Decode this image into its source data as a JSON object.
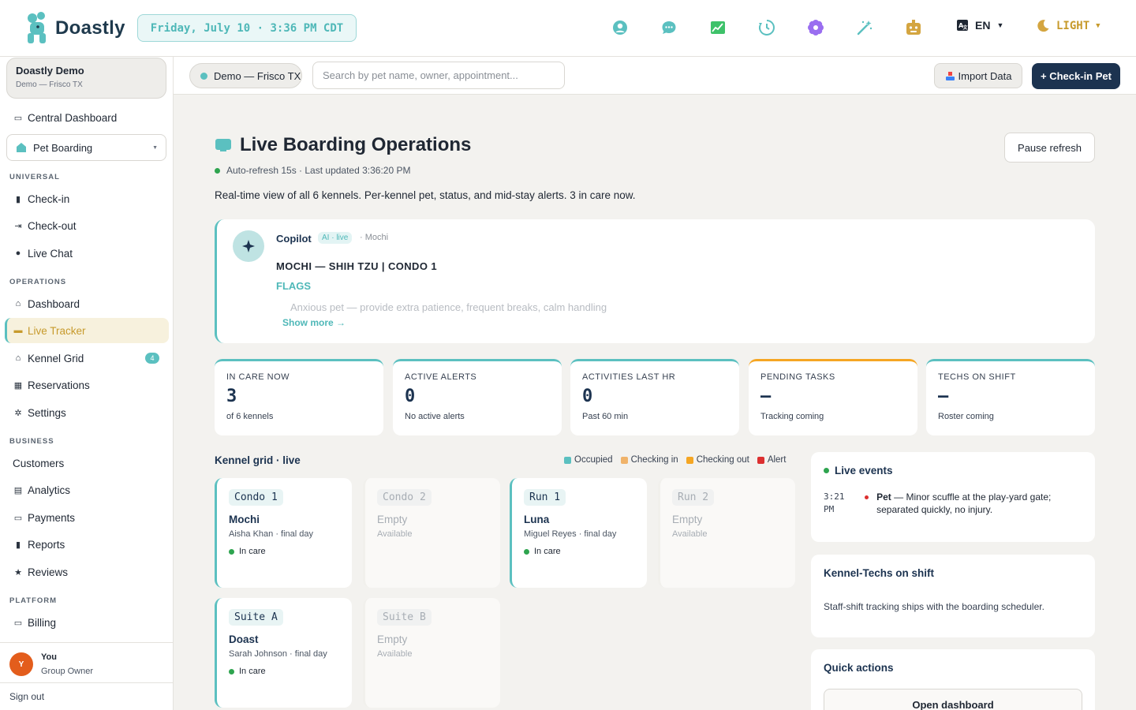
{
  "app": {
    "name": "Doastly"
  },
  "topbar": {
    "datetime": "Friday, July 10 · 3:36 PM CDT",
    "language": "EN",
    "theme": "LIGHT",
    "icons": [
      "user-circle-icon",
      "chat-bubble-icon",
      "chart-image-icon",
      "history-clock-icon",
      "flower-icon",
      "magic-wand-icon",
      "robot-icon"
    ]
  },
  "sidebar": {
    "org_name": "Doastly Demo",
    "org_location": "Demo — Frisco TX",
    "central_dashboard": "Central Dashboard",
    "module_select": "Pet Boarding",
    "sections": {
      "universal": "UNIVERSAL",
      "operations": "OPERATIONS",
      "business": "BUSINESS",
      "platform": "PLATFORM"
    },
    "universal_items": [
      "Check-in",
      "Check-out",
      "Live Chat"
    ],
    "operations_items": [
      "Dashboard",
      "Live Tracker",
      "Kennel Grid",
      "Reservations",
      "Settings"
    ],
    "kennel_grid_badge": "4",
    "business_items": [
      "Customers",
      "Analytics",
      "Payments",
      "Reports",
      "Reviews"
    ],
    "platform_items": [
      "Billing"
    ],
    "user": {
      "initial": "Y",
      "name": "You",
      "role": "Group Owner"
    },
    "signout": "Sign out"
  },
  "subheader": {
    "location": "Demo — Frisco TX",
    "search_placeholder": "Search by pet name, owner, appointment...",
    "import_label": "Import Data",
    "checkin_label": "+ Check-in Pet"
  },
  "main": {
    "title": "Live Boarding Operations",
    "pause_label": "Pause refresh",
    "refresh_status": "Auto-refresh 15s · Last updated 3:36:20 PM",
    "description": "Real-time view of all 6 kennels. Per-kennel pet, status, and mid-stay alerts. 3 in care now."
  },
  "copilot": {
    "name": "Copilot",
    "tag": "AI · live",
    "pet": "· Mochi",
    "heading": "MOCHI — SHIH TZU | CONDO 1",
    "flags_label": "FLAGS",
    "flag_text": "Anxious pet — provide extra patience, frequent breaks, calm handling",
    "show_more": "Show more →"
  },
  "stats": [
    {
      "label": "IN CARE NOW",
      "value": "3",
      "sub": "of 6 kennels"
    },
    {
      "label": "ACTIVE ALERTS",
      "value": "0",
      "sub": "No active alerts"
    },
    {
      "label": "ACTIVITIES LAST HR",
      "value": "0",
      "sub": "Past 60 min"
    },
    {
      "label": "PENDING TASKS",
      "value": "—",
      "sub": "Tracking coming"
    },
    {
      "label": "TECHS ON SHIFT",
      "value": "—",
      "sub": "Roster coming"
    }
  ],
  "kennel_grid": {
    "title": "Kennel grid · live",
    "legend": [
      {
        "label": "Occupied",
        "color": "#5bc0c0"
      },
      {
        "label": "Checking in",
        "color": "#f0b36a"
      },
      {
        "label": "Checking out",
        "color": "#f5a623"
      },
      {
        "label": "Alert",
        "color": "#dc3030"
      }
    ],
    "kennels": [
      {
        "tag": "Condo 1",
        "name": "Mochi",
        "owner": "Aisha Khan · final day",
        "status": "In care"
      },
      {
        "tag": "Condo 2",
        "name": "Empty",
        "owner": "Available",
        "status": ""
      },
      {
        "tag": "Run 1",
        "name": "Luna",
        "owner": "Miguel Reyes · final day",
        "status": "In care"
      },
      {
        "tag": "Run 2",
        "name": "Empty",
        "owner": "Available",
        "status": ""
      },
      {
        "tag": "Suite A",
        "name": "Doast",
        "owner": "Sarah Johnson · final day",
        "status": "In care"
      },
      {
        "tag": "Suite B",
        "name": "Empty",
        "owner": "Available",
        "status": ""
      }
    ]
  },
  "live_events": {
    "title": "Live events",
    "events": [
      {
        "time": "3:21 PM",
        "pet": "Pet",
        "text": " — Minor scuffle at the play-yard gate; separated quickly, no injury."
      }
    ]
  },
  "techs": {
    "title": "Kennel-Techs on shift",
    "text": "Staff-shift tracking ships with the boarding scheduler."
  },
  "quick_actions": {
    "title": "Quick actions",
    "open_dashboard": "Open dashboard"
  }
}
